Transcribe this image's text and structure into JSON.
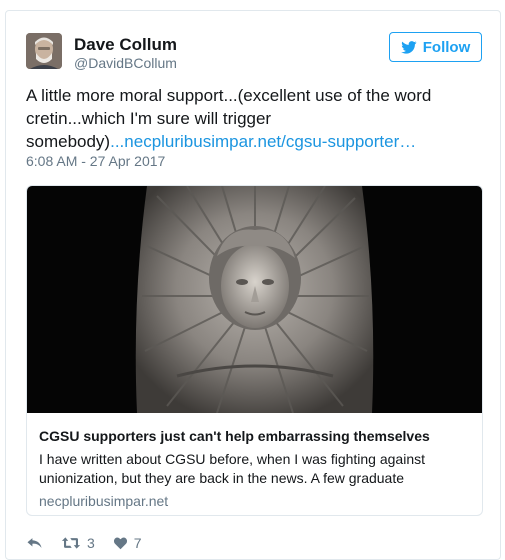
{
  "author": {
    "name": "Dave Collum",
    "handle": "@DavidBCollum"
  },
  "follow_button": {
    "label": "Follow"
  },
  "tweet": {
    "text_line1": "A little more moral support...(excellent use of the word",
    "text_line2": "cretin...which I'm sure will trigger",
    "text_line3_prefix": "somebody)",
    "link": "...necpluribusimpar.net/cgsu-supporter…",
    "timestamp": "6:08 AM - 27 Apr 2017"
  },
  "card": {
    "title": "CGSU supporters just can't help embarrassing themselves",
    "description": "I have written about CGSU before, when I was fighting against unionization, but they are back in the news. A few graduate",
    "domain": "necpluribusimpar.net"
  },
  "actions": {
    "retweet_count": "3",
    "like_count": "7"
  },
  "colors": {
    "accent": "#1da1f2",
    "link": "#1b95e0",
    "muted": "#657786",
    "border": "#e1e8ed"
  },
  "icons": {
    "follow": "twitter-bird-icon",
    "reply": "reply-icon",
    "retweet": "retweet-icon",
    "like": "heart-icon"
  }
}
